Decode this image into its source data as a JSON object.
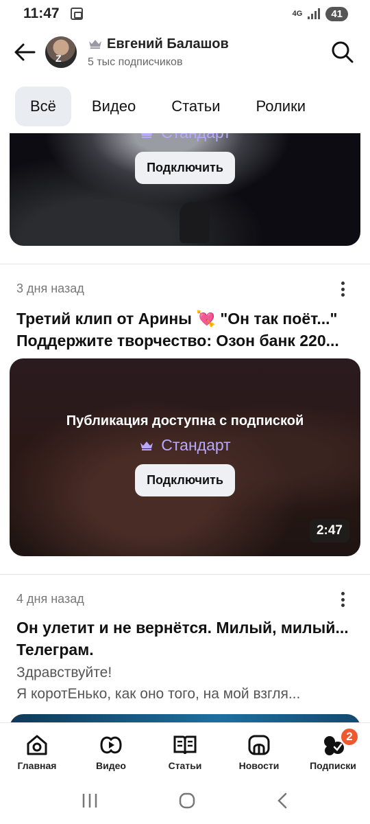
{
  "status_bar": {
    "time": "11:47",
    "network": "4G",
    "battery": "41"
  },
  "header": {
    "channel_name": "Евгений Балашов",
    "subscribers": "5 тыс подписчиков",
    "icons": [
      "back-arrow-icon",
      "crown-icon",
      "search-icon"
    ]
  },
  "tabs": [
    {
      "label": "Всё",
      "active": true
    },
    {
      "label": "Видео",
      "active": false
    },
    {
      "label": "Статьи",
      "active": false
    },
    {
      "label": "Ролики",
      "active": false
    }
  ],
  "feed": {
    "card1": {
      "tier": "Стандарт",
      "button": "Подключить"
    },
    "card2": {
      "date": "3 дня назад",
      "title_line1": "Третий клип от Арины 💘 \"Он так поёт...\"",
      "title_line2": "Поддержите творчество: Озон банк 220...",
      "locked_text": "Публикация доступна с подпиской",
      "tier": "Стандарт",
      "button": "Подключить",
      "duration": "2:47"
    },
    "card3": {
      "date": "4 дня назад",
      "title_line1": "Он улетит и не вернётся. Милый, милый...",
      "title_line2": "Телеграм.",
      "excerpt_line1": "Здравствуйте!",
      "excerpt_line2": "Я коротЕнько, как оно того, на мой взгля..."
    }
  },
  "bottom_nav": [
    {
      "label": "Главная",
      "icon": "home-icon"
    },
    {
      "label": "Видео",
      "icon": "video-icon"
    },
    {
      "label": "Статьи",
      "icon": "articles-icon"
    },
    {
      "label": "Новости",
      "icon": "news-icon"
    },
    {
      "label": "Подписки",
      "icon": "subscriptions-icon",
      "badge": "2"
    }
  ],
  "colors": {
    "tier_accent": "#b9a8ff",
    "badge": "#f0592f",
    "active_tab_bg": "#e9ecf1"
  }
}
